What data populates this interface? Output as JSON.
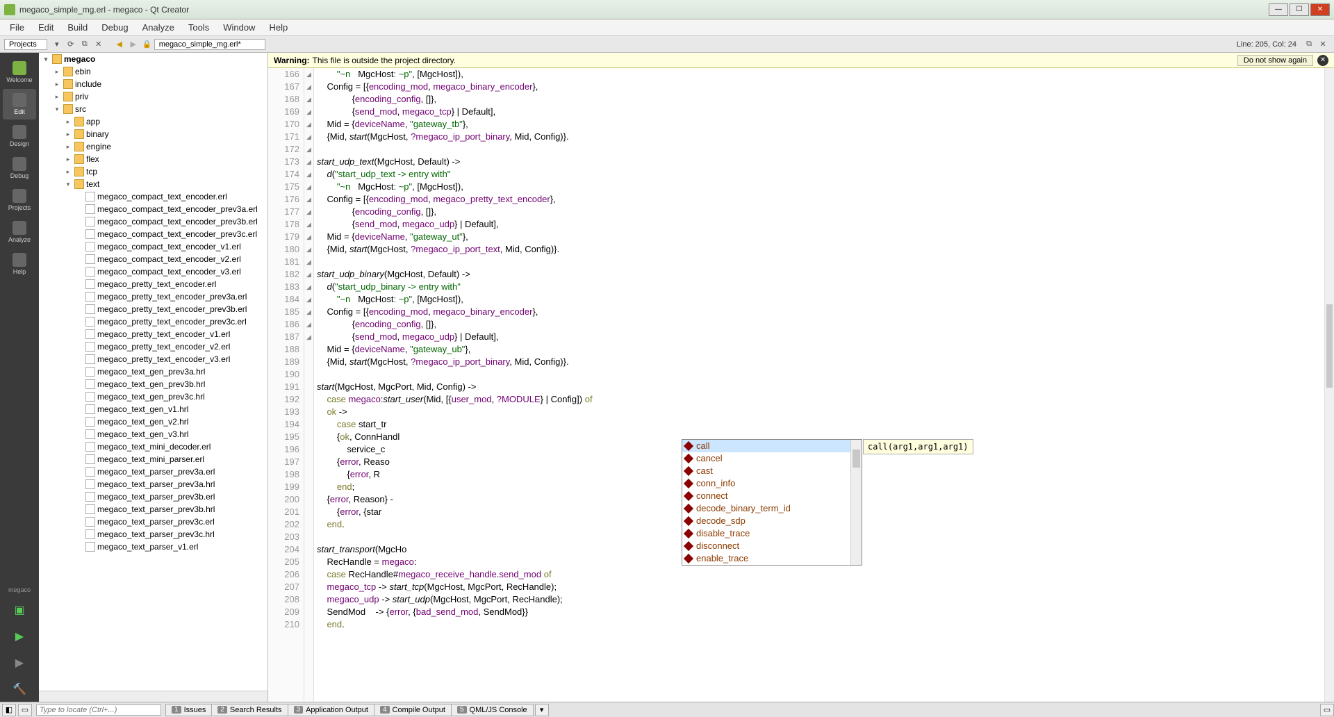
{
  "window": {
    "title": "megaco_simple_mg.erl - megaco - Qt Creator"
  },
  "menus": [
    "File",
    "Edit",
    "Build",
    "Debug",
    "Analyze",
    "Tools",
    "Window",
    "Help"
  ],
  "toolbar": {
    "project_combo": "Projects",
    "open_doc": "megaco_simple_mg.erl*",
    "linecol": "Line: 205, Col: 24"
  },
  "sidebar": {
    "items": [
      {
        "label": "Welcome"
      },
      {
        "label": "Edit"
      },
      {
        "label": "Design"
      },
      {
        "label": "Debug"
      },
      {
        "label": "Projects"
      },
      {
        "label": "Analyze"
      },
      {
        "label": "Help"
      }
    ],
    "bottom_label": "megaco"
  },
  "tree": {
    "root": "megaco",
    "folders": [
      "ebin",
      "include",
      "priv",
      "src"
    ],
    "src_folders": [
      "app",
      "binary",
      "engine",
      "flex",
      "tcp",
      "text"
    ],
    "text_files": [
      "megaco_compact_text_encoder.erl",
      "megaco_compact_text_encoder_prev3a.erl",
      "megaco_compact_text_encoder_prev3b.erl",
      "megaco_compact_text_encoder_prev3c.erl",
      "megaco_compact_text_encoder_v1.erl",
      "megaco_compact_text_encoder_v2.erl",
      "megaco_compact_text_encoder_v3.erl",
      "megaco_pretty_text_encoder.erl",
      "megaco_pretty_text_encoder_prev3a.erl",
      "megaco_pretty_text_encoder_prev3b.erl",
      "megaco_pretty_text_encoder_prev3c.erl",
      "megaco_pretty_text_encoder_v1.erl",
      "megaco_pretty_text_encoder_v2.erl",
      "megaco_pretty_text_encoder_v3.erl",
      "megaco_text_gen_prev3a.hrl",
      "megaco_text_gen_prev3b.hrl",
      "megaco_text_gen_prev3c.hrl",
      "megaco_text_gen_v1.hrl",
      "megaco_text_gen_v2.hrl",
      "megaco_text_gen_v3.hrl",
      "megaco_text_mini_decoder.erl",
      "megaco_text_mini_parser.erl",
      "megaco_text_parser_prev3a.erl",
      "megaco_text_parser_prev3a.hrl",
      "megaco_text_parser_prev3b.erl",
      "megaco_text_parser_prev3b.hrl",
      "megaco_text_parser_prev3c.erl",
      "megaco_text_parser_prev3c.hrl",
      "megaco_text_parser_v1.erl"
    ]
  },
  "warning": {
    "label": "Warning:",
    "text": "This file is outside the project directory.",
    "button": "Do not show again"
  },
  "code": {
    "first_line": 166,
    "lines": [
      "        \"~n   MgcHost: ~p\", [MgcHost]),",
      "    Config = [{encoding_mod, megaco_binary_encoder},",
      "              {encoding_config, []},",
      "              {send_mod, megaco_tcp} | Default],",
      "    Mid = {deviceName, \"gateway_tb\"},",
      "    {Mid, start(MgcHost, ?megaco_ip_port_binary, Mid, Config)}.",
      "",
      "start_udp_text(MgcHost, Default) ->",
      "    d(\"start_udp_text -> entry with\"",
      "        \"~n   MgcHost: ~p\", [MgcHost]),",
      "    Config = [{encoding_mod, megaco_pretty_text_encoder},",
      "              {encoding_config, []},",
      "              {send_mod, megaco_udp} | Default],",
      "    Mid = {deviceName, \"gateway_ut\"},",
      "    {Mid, start(MgcHost, ?megaco_ip_port_text, Mid, Config)}.",
      "",
      "start_udp_binary(MgcHost, Default) ->",
      "    d(\"start_udp_binary -> entry with\"",
      "        \"~n   MgcHost: ~p\", [MgcHost]),",
      "    Config = [{encoding_mod, megaco_binary_encoder},",
      "              {encoding_config, []},",
      "              {send_mod, megaco_udp} | Default],",
      "    Mid = {deviceName, \"gateway_ub\"},",
      "    {Mid, start(MgcHost, ?megaco_ip_port_binary, Mid, Config)}.",
      "",
      "start(MgcHost, MgcPort, Mid, Config) ->",
      "    case megaco:start_user(Mid, [{user_mod, ?MODULE} | Config]) of",
      "    ok ->",
      "        case start_tr",
      "        {ok, ConnHandl",
      "            service_c",
      "        {error, Reaso",
      "            {error, R",
      "        end;",
      "    {error, Reason} -",
      "        {error, {star",
      "    end.",
      "",
      "start_transport(MgcHo",
      "    RecHandle = megaco:",
      "    case RecHandle#megaco_receive_handle.send_mod of",
      "    megaco_tcp -> start_tcp(MgcHost, MgcPort, RecHandle);",
      "    megaco_udp -> start_udp(MgcHost, MgcPort, RecHandle);",
      "    SendMod    -> {error, {bad_send_mod, SendMod}}",
      "    end."
    ],
    "fold_markers": [
      167,
      170,
      173,
      174,
      177,
      180,
      182,
      183,
      186,
      189,
      191,
      192,
      193,
      194,
      195,
      197,
      199,
      200,
      202,
      204,
      205,
      206
    ]
  },
  "autocomplete": {
    "items": [
      "call",
      "cancel",
      "cast",
      "conn_info",
      "connect",
      "decode_binary_term_id",
      "decode_sdp",
      "disable_trace",
      "disconnect",
      "enable_trace"
    ],
    "selected": 0,
    "signature": "call(arg1,arg1,arg1)"
  },
  "statusbar": {
    "locate_placeholder": "Type to locate (Ctrl+...)",
    "tabs": [
      {
        "n": "1",
        "label": "Issues"
      },
      {
        "n": "2",
        "label": "Search Results"
      },
      {
        "n": "3",
        "label": "Application Output"
      },
      {
        "n": "4",
        "label": "Compile Output"
      },
      {
        "n": "5",
        "label": "QML/JS Console"
      }
    ]
  }
}
